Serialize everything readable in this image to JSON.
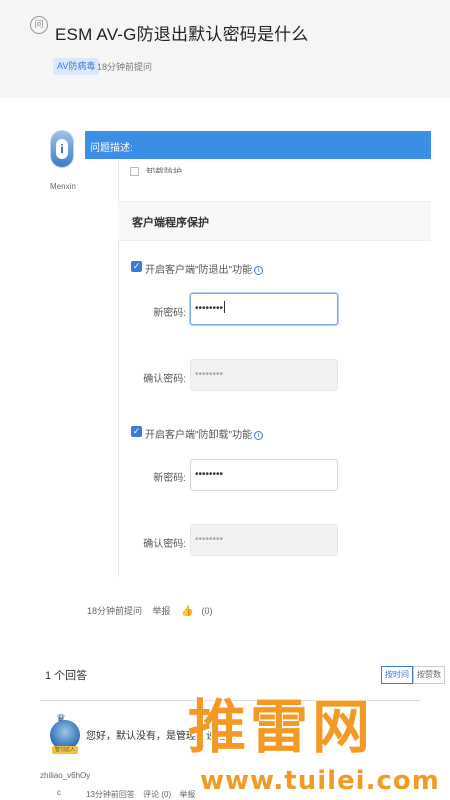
{
  "question": {
    "icon": "问",
    "title": "ESM AV-G防退出默认密码是什么",
    "tag": "AV防病毒",
    "asked_time": "18分钟前提问",
    "description_label": "问题描述:"
  },
  "asker": {
    "avatar_letter": "i",
    "name": "Menxin"
  },
  "screenshot": {
    "cut_option": "卸载防护",
    "section_title": "客户端程序保护",
    "anti_exit": {
      "label": "开启客户端\"防退出\"功能",
      "new_pwd_label": "新密码:",
      "new_pwd_value": "••••••••",
      "confirm_pwd_label": "确认密码:",
      "confirm_pwd_value": "••••••••"
    },
    "anti_uninstall": {
      "label": "开启客户端\"防卸载\"功能",
      "new_pwd_label": "新密码:",
      "new_pwd_value": "••••••••",
      "confirm_pwd_label": "确认密码:",
      "confirm_pwd_value": "••••••••"
    }
  },
  "question_meta": {
    "time": "18分钟前提问",
    "report": "举报",
    "likes": "(0)"
  },
  "answers": {
    "count_label": "1 个回答",
    "sort_time": "按时间",
    "sort_votes": "按赞数",
    "items": [
      {
        "user_line1": "zhiliao_v6hOy",
        "user_line2": "c",
        "badge": "智习达人",
        "text": "您好，默认没有，是管理员设置的",
        "time": "13分钟前回答",
        "comment": "评论 (0)",
        "report": "举报"
      }
    ]
  },
  "watermark": {
    "brand": "推雷网",
    "url": "www.tuilei.com"
  },
  "colors": {
    "accent": "#3a8ee6",
    "watermark": "#f39a24"
  }
}
